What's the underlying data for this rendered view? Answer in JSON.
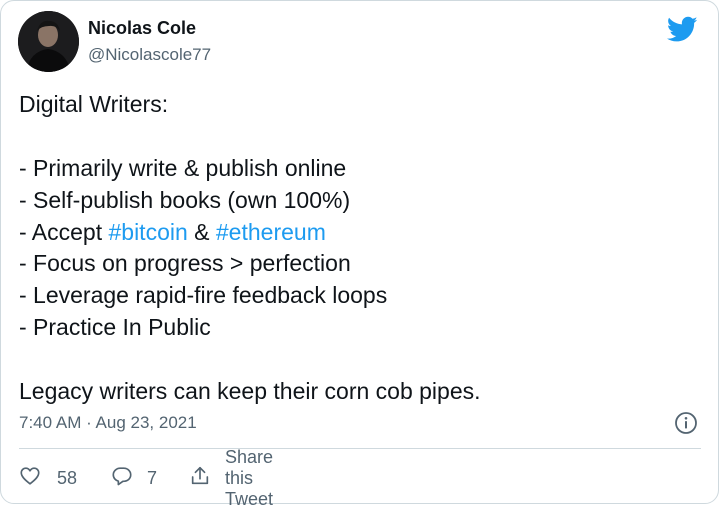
{
  "author": {
    "name": "Nicolas Cole",
    "handle": "@Nicolascole77"
  },
  "tweet": {
    "lines": [
      [
        {
          "text": "Digital Writers:"
        }
      ],
      [
        {
          "text": ""
        }
      ],
      [
        {
          "text": "- Primarily write & publish online"
        }
      ],
      [
        {
          "text": "- Self-publish books (own 100%)"
        }
      ],
      [
        {
          "text": "- Accept "
        },
        {
          "text": "#bitcoin",
          "hashtag": true
        },
        {
          "text": " & "
        },
        {
          "text": "#ethereum",
          "hashtag": true
        }
      ],
      [
        {
          "text": "- Focus on progress > perfection"
        }
      ],
      [
        {
          "text": "- Leverage rapid-fire feedback loops"
        }
      ],
      [
        {
          "text": "- Practice In Public"
        }
      ],
      [
        {
          "text": ""
        }
      ],
      [
        {
          "text": "Legacy writers can keep their corn cob pipes."
        }
      ]
    ],
    "timestamp": "7:40 AM · Aug 23, 2021"
  },
  "actions": {
    "likes": "58",
    "replies": "7",
    "share_label": "Share this Tweet"
  },
  "icons": {
    "brand": "twitter-bird-icon",
    "info": "info-icon",
    "like": "heart-icon",
    "reply": "reply-bubble-icon",
    "share": "share-icon"
  },
  "colors": {
    "brand": "#1d9bf0",
    "hashtag": "#1d9bf0",
    "secondary_text": "#536471",
    "border": "#cfd9de"
  }
}
